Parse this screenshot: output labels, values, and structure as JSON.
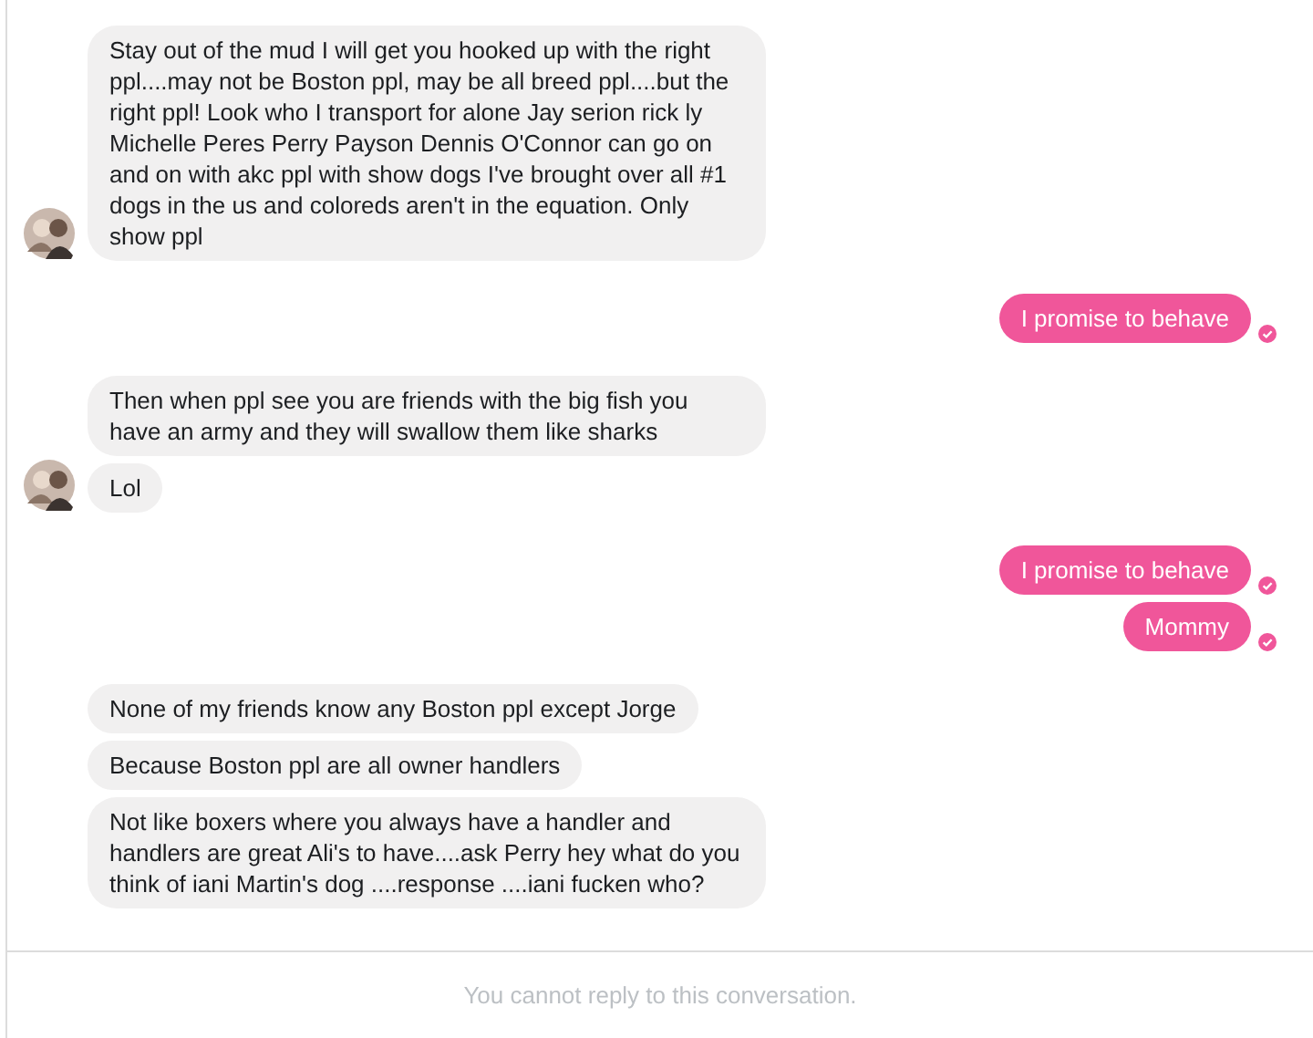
{
  "groups": [
    {
      "kind": "them",
      "avatar": true,
      "messages": [
        "Stay out of the mud I will get you hooked up with the right ppl....may not be Boston ppl, may be all breed ppl....but the right ppl! Look who I transport for alone Jay serion rick ly Michelle Peres Perry Payson Dennis O'Connor can go on and on with akc ppl with show dogs I've brought over all #1 dogs in the us and coloreds aren't in the equation. Only show ppl"
      ]
    },
    {
      "kind": "me",
      "messages": [
        "I promise to behave"
      ]
    },
    {
      "kind": "them",
      "avatar": true,
      "messages": [
        "Then when ppl see you are friends with the big fish you have an army and they will swallow them like sharks",
        "Lol"
      ]
    },
    {
      "kind": "me",
      "messages": [
        "I promise to behave",
        "Mommy"
      ]
    },
    {
      "kind": "them",
      "avatar": false,
      "messages": [
        "None of my friends know any Boston ppl except Jorge",
        "Because Boston ppl are all owner handlers",
        "Not like boxers where you always have a handler and handlers are great Ali's to have....ask Perry hey what do you think of iani Martin's dog ....response ....iani fucken who?"
      ]
    }
  ],
  "footer": {
    "notice": "You cannot reply to this conversation."
  }
}
